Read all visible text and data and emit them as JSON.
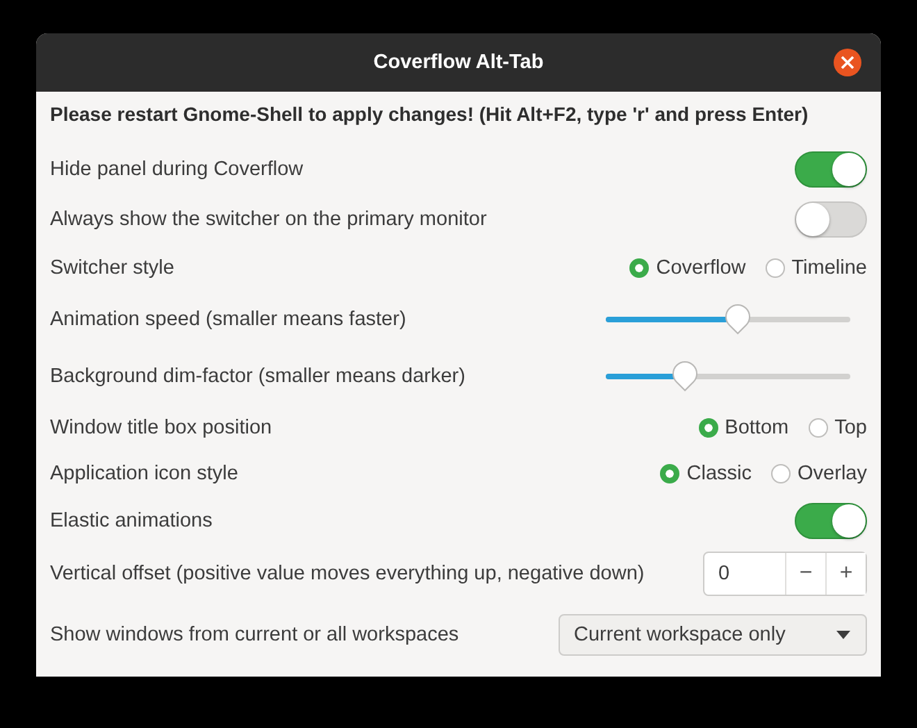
{
  "window": {
    "title": "Coverflow Alt-Tab"
  },
  "notice": "Please restart Gnome-Shell to apply changes! (Hit Alt+F2, type 'r' and press Enter)",
  "settings": [
    {
      "kind": "switch",
      "label": "Hide panel during Coverflow",
      "on": true
    },
    {
      "kind": "switch",
      "label": "Always show the switcher on the primary monitor",
      "on": false
    },
    {
      "kind": "radio",
      "label": "Switcher style",
      "options": [
        {
          "label": "Coverflow",
          "selected": true
        },
        {
          "label": "Timeline",
          "selected": false
        }
      ]
    },
    {
      "kind": "slider",
      "label": "Animation speed (smaller means faster)",
      "level": 0.5
    },
    {
      "kind": "slider",
      "label": "Background dim-factor (smaller means darker)",
      "level": 0.3
    },
    {
      "kind": "radio",
      "label": "Window title box position",
      "options": [
        {
          "label": "Bottom",
          "selected": true
        },
        {
          "label": "Top",
          "selected": false
        }
      ]
    },
    {
      "kind": "radio",
      "label": "Application icon style",
      "options": [
        {
          "label": "Classic",
          "selected": true
        },
        {
          "label": "Overlay",
          "selected": false
        }
      ]
    },
    {
      "kind": "switch",
      "label": "Elastic animations",
      "on": true
    },
    {
      "kind": "spin",
      "label": "Vertical offset (positive value moves everything up, negative down)",
      "value": "0",
      "minus": "−",
      "plus": "+"
    },
    {
      "kind": "combo",
      "label": "Show windows from current or all workspaces",
      "value": "Current workspace only"
    }
  ]
}
